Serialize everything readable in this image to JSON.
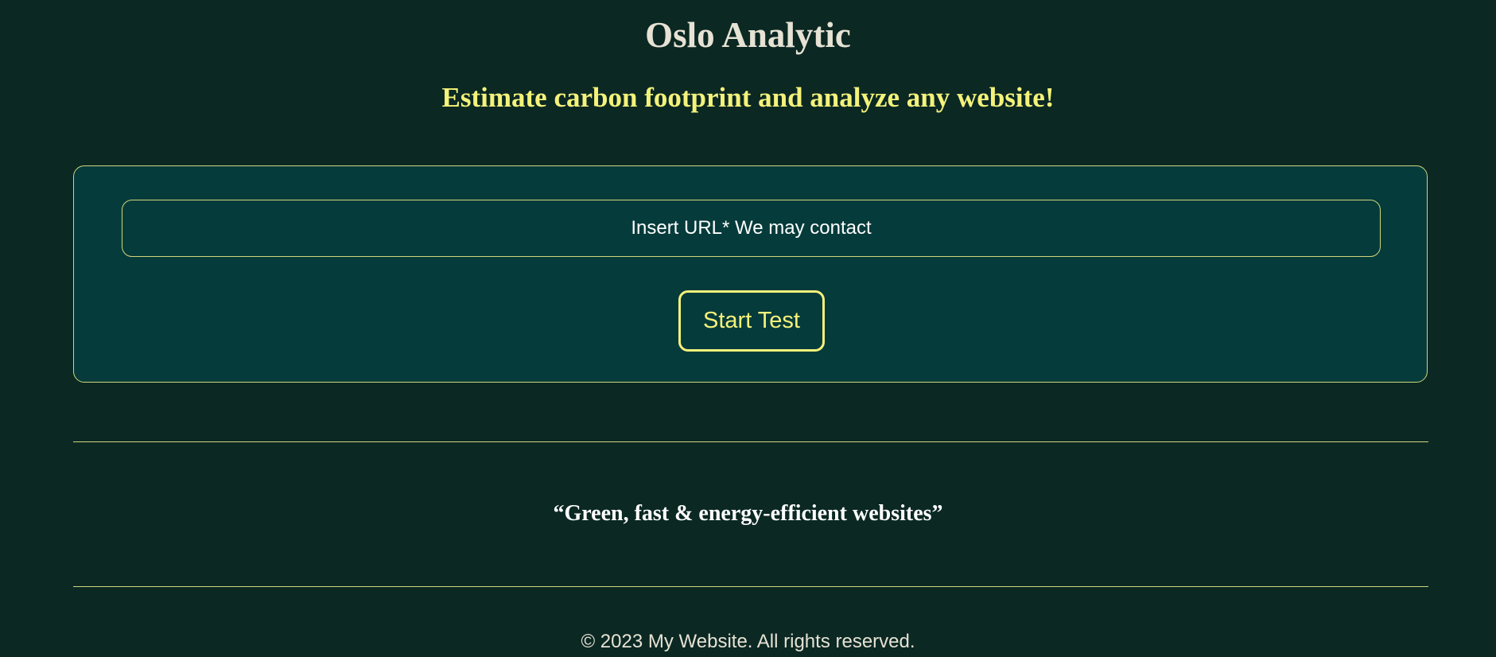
{
  "header": {
    "title": "Oslo Analytic",
    "tagline": "Estimate carbon footprint and analyze any website!"
  },
  "test_form": {
    "url_placeholder": "Insert URL* We may contact",
    "url_value": "",
    "start_label": "Start Test"
  },
  "slogan": {
    "text": "“Green, fast & energy-efficient websites”"
  },
  "footer": {
    "copyright": "© 2023 My Website. All rights reserved."
  },
  "colors": {
    "background": "#0b2823",
    "panel": "#063b3b",
    "accent": "#f4f27a",
    "border": "#cfd67a",
    "title": "#e6e2d4"
  }
}
